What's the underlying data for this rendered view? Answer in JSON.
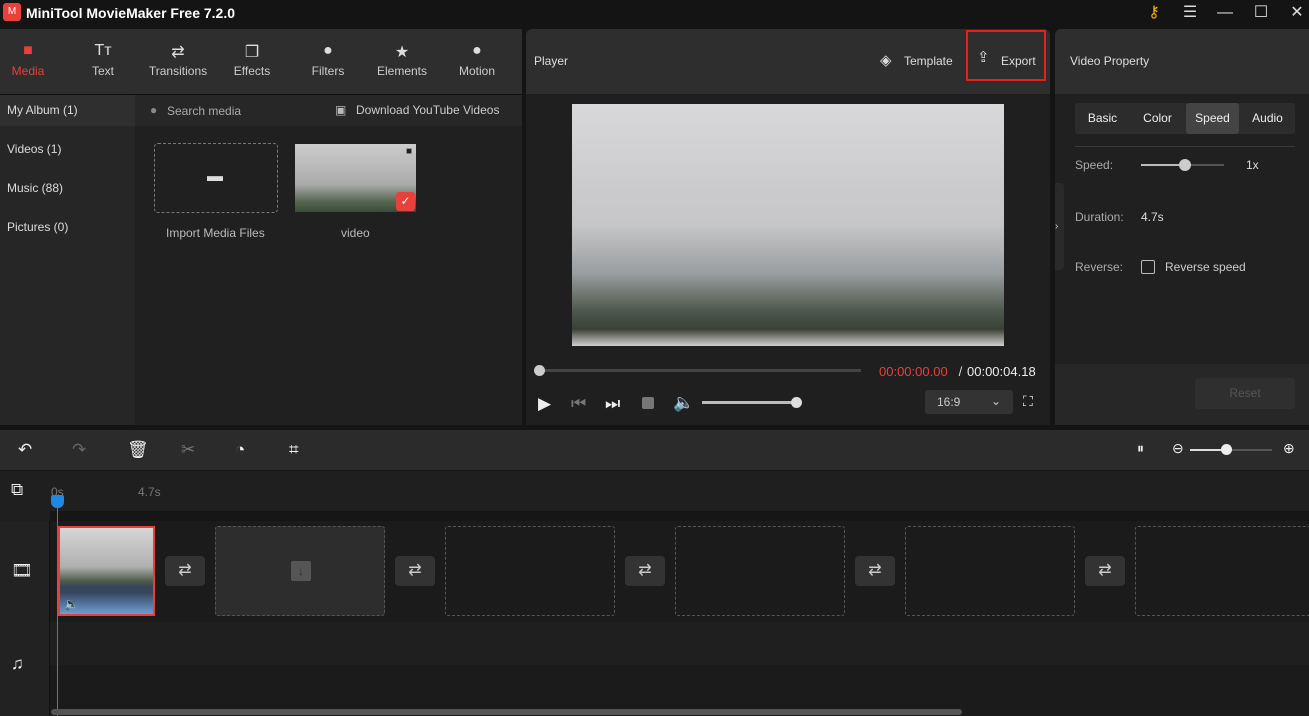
{
  "app": {
    "title": "MiniTool MovieMaker Free 7.2.0"
  },
  "toolbar_tabs": [
    {
      "label": "Media",
      "icon": "folder-icon",
      "active": true
    },
    {
      "label": "Text",
      "icon": "text-icon"
    },
    {
      "label": "Transitions",
      "icon": "transitions-icon"
    },
    {
      "label": "Effects",
      "icon": "effects-icon"
    },
    {
      "label": "Filters",
      "icon": "filters-icon"
    },
    {
      "label": "Elements",
      "icon": "elements-icon"
    },
    {
      "label": "Motion",
      "icon": "motion-icon"
    }
  ],
  "sidebar": {
    "items": [
      {
        "label": "My Album (1)",
        "selected": true
      },
      {
        "label": "Videos (1)"
      },
      {
        "label": "Music (88)"
      },
      {
        "label": "Pictures (0)"
      }
    ]
  },
  "media": {
    "search_placeholder": "Search media",
    "download_label": "Download YouTube Videos",
    "import_label": "Import Media Files",
    "video_label": "video"
  },
  "player": {
    "title": "Player",
    "template_label": "Template",
    "export_label": "Export",
    "current_time": "00:00:00.00",
    "separator": " / ",
    "total_time": "00:00:04.18",
    "aspect": "16:9",
    "progress": 0,
    "volume": 1.0
  },
  "property": {
    "title": "Video Property",
    "tabs": [
      "Basic",
      "Color",
      "Speed",
      "Audio"
    ],
    "active_tab": "Speed",
    "speed_label": "Speed:",
    "speed_value": "1x",
    "duration_label": "Duration:",
    "duration_value": "4.7s",
    "reverse_label": "Reverse:",
    "reverse_checkbox": "Reverse speed",
    "reverse_checked": false,
    "reset_label": "Reset"
  },
  "timeline": {
    "ruler": [
      "0s",
      "4.7s"
    ]
  },
  "colors": {
    "accent": "#e8403a",
    "playhead": "#1e88e5"
  }
}
